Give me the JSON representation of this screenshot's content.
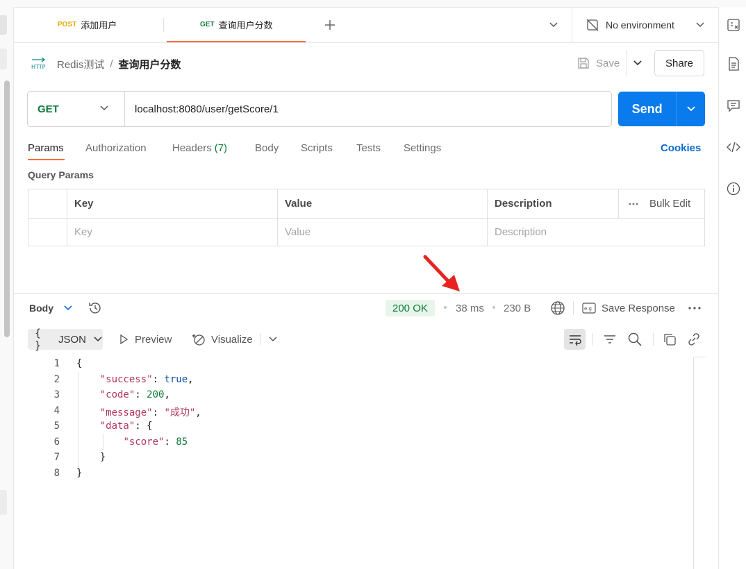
{
  "tabs": [
    {
      "method": "POST",
      "name": "添加用户",
      "method_color": "#f4b400"
    },
    {
      "method": "GET",
      "name": "查询用户分数",
      "method_color": "#0f7a3a"
    }
  ],
  "environment": {
    "label": "No environment"
  },
  "breadcrumb": {
    "parent": "Redis测试",
    "separator": "/",
    "current": "查询用户分数"
  },
  "header_actions": {
    "save": "Save",
    "share": "Share"
  },
  "request": {
    "method": "GET",
    "url": "localhost:8080/user/getScore/1",
    "send": "Send"
  },
  "request_tabs": [
    {
      "label": "Params"
    },
    {
      "label": "Authorization"
    },
    {
      "label": "Headers",
      "count": "(7)"
    },
    {
      "label": "Body"
    },
    {
      "label": "Scripts"
    },
    {
      "label": "Tests"
    },
    {
      "label": "Settings"
    }
  ],
  "cookies_link": "Cookies",
  "query_params": {
    "title": "Query Params",
    "columns": [
      "Key",
      "Value",
      "Description"
    ],
    "bulk_edit": "Bulk Edit",
    "placeholders": [
      "Key",
      "Value",
      "Description"
    ]
  },
  "response": {
    "body_label": "Body",
    "status": "200 OK",
    "time": "38 ms",
    "size": "230 B",
    "save_response": "Save Response",
    "format": "JSON",
    "format_prefix": "{ }",
    "preview": "Preview",
    "visualize": "Visualize",
    "line_numbers": [
      "1",
      "2",
      "3",
      "4",
      "5",
      "6",
      "7",
      "8"
    ],
    "json": {
      "success_key": "\"success\"",
      "success_val": "true",
      "code_key": "\"code\"",
      "code_val": "200",
      "message_key": "\"message\"",
      "message_val": "\"成功\"",
      "data_key": "\"data\"",
      "score_key": "\"score\"",
      "score_val": "85"
    }
  },
  "colors": {
    "accent": "#ff6c37",
    "send": "#097bed",
    "get": "#0f7a3a",
    "post": "#f4b400",
    "annotation_arrow": "#e8231f"
  }
}
